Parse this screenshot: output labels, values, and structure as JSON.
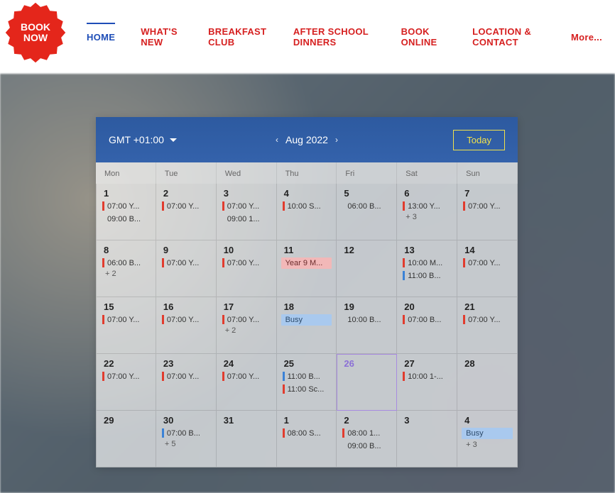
{
  "badge": {
    "line1": "BOOK",
    "line2": "NOW"
  },
  "nav": [
    {
      "label": "HOME",
      "cls": "active"
    },
    {
      "label": "WHAT'S NEW",
      "cls": "red"
    },
    {
      "label": "BREAKFAST CLUB",
      "cls": "red"
    },
    {
      "label": "AFTER SCHOOL DINNERS",
      "cls": "red"
    },
    {
      "label": "BOOK ONLINE",
      "cls": "red"
    },
    {
      "label": "LOCATION & CONTACT",
      "cls": "red"
    },
    {
      "label": "More...",
      "cls": "red"
    }
  ],
  "calendar": {
    "tz": "GMT +01:00",
    "month": "Aug 2022",
    "today": "Today",
    "dow": [
      "Mon",
      "Tue",
      "Wed",
      "Thu",
      "Fri",
      "Sat",
      "Sun"
    ],
    "weeks": [
      [
        {
          "n": "1",
          "ev": [
            {
              "t": "07:00 Y...",
              "c": "red"
            },
            {
              "t": "09:00 B...",
              "c": ""
            }
          ]
        },
        {
          "n": "2",
          "ev": [
            {
              "t": "07:00 Y...",
              "c": "red"
            }
          ]
        },
        {
          "n": "3",
          "ev": [
            {
              "t": "07:00 Y...",
              "c": "red"
            },
            {
              "t": "09:00 1...",
              "c": ""
            }
          ]
        },
        {
          "n": "4",
          "ev": [
            {
              "t": "10:00 S...",
              "c": "red"
            }
          ]
        },
        {
          "n": "5",
          "ev": [
            {
              "t": "06:00 B...",
              "c": ""
            }
          ]
        },
        {
          "n": "6",
          "ev": [
            {
              "t": "13:00 Y...",
              "c": "red"
            }
          ],
          "more": "+ 3"
        },
        {
          "n": "7",
          "ev": [
            {
              "t": "07:00 Y...",
              "c": "red"
            }
          ]
        }
      ],
      [
        {
          "n": "8",
          "ev": [
            {
              "t": "06:00 B...",
              "c": "red"
            }
          ],
          "more": "+ 2"
        },
        {
          "n": "9",
          "ev": [
            {
              "t": "07:00 Y...",
              "c": "red"
            }
          ]
        },
        {
          "n": "10",
          "ev": [
            {
              "t": "07:00 Y...",
              "c": "red"
            }
          ]
        },
        {
          "n": "11",
          "ev": [
            {
              "t": "Year 9 M...",
              "block": "pink"
            }
          ]
        },
        {
          "n": "12",
          "ev": []
        },
        {
          "n": "13",
          "ev": [
            {
              "t": "10:00 M...",
              "c": "red"
            },
            {
              "t": "11:00 B...",
              "c": "blue"
            }
          ]
        },
        {
          "n": "14",
          "ev": [
            {
              "t": "07:00 Y...",
              "c": "red"
            }
          ]
        }
      ],
      [
        {
          "n": "15",
          "ev": [
            {
              "t": "07:00 Y...",
              "c": "red"
            }
          ]
        },
        {
          "n": "16",
          "ev": [
            {
              "t": "07:00 Y...",
              "c": "red"
            }
          ]
        },
        {
          "n": "17",
          "ev": [
            {
              "t": "07:00 Y...",
              "c": "red"
            }
          ],
          "more": "+ 2"
        },
        {
          "n": "18",
          "ev": [
            {
              "t": "Busy",
              "block": "blue"
            }
          ]
        },
        {
          "n": "19",
          "ev": [
            {
              "t": "10:00 B...",
              "c": ""
            }
          ]
        },
        {
          "n": "20",
          "ev": [
            {
              "t": "07:00 B...",
              "c": "red"
            }
          ]
        },
        {
          "n": "21",
          "ev": [
            {
              "t": "07:00 Y...",
              "c": "red"
            }
          ]
        }
      ],
      [
        {
          "n": "22",
          "ev": [
            {
              "t": "07:00 Y...",
              "c": "red"
            }
          ]
        },
        {
          "n": "23",
          "ev": [
            {
              "t": "07:00 Y...",
              "c": "red"
            }
          ]
        },
        {
          "n": "24",
          "ev": [
            {
              "t": "07:00 Y...",
              "c": "red"
            }
          ]
        },
        {
          "n": "25",
          "ev": [
            {
              "t": "11:00 B...",
              "c": "blue"
            },
            {
              "t": "11:00 Sc...",
              "c": "red"
            }
          ]
        },
        {
          "n": "26",
          "ev": [],
          "today": true
        },
        {
          "n": "27",
          "ev": [
            {
              "t": "10:00 1-...",
              "c": "red"
            }
          ]
        },
        {
          "n": "28",
          "ev": []
        }
      ],
      [
        {
          "n": "29",
          "ev": []
        },
        {
          "n": "30",
          "ev": [
            {
              "t": "07:00 B...",
              "c": "blue"
            }
          ],
          "more": "+ 5"
        },
        {
          "n": "31",
          "ev": []
        },
        {
          "n": "1",
          "ev": [
            {
              "t": "08:00 S...",
              "c": "red"
            }
          ]
        },
        {
          "n": "2",
          "ev": [
            {
              "t": "08:00 1...",
              "c": "red"
            },
            {
              "t": "09:00 B...",
              "c": ""
            }
          ]
        },
        {
          "n": "3",
          "ev": []
        },
        {
          "n": "4",
          "ev": [
            {
              "t": "Busy",
              "block": "blue"
            }
          ],
          "more": "+ 3"
        }
      ]
    ]
  }
}
